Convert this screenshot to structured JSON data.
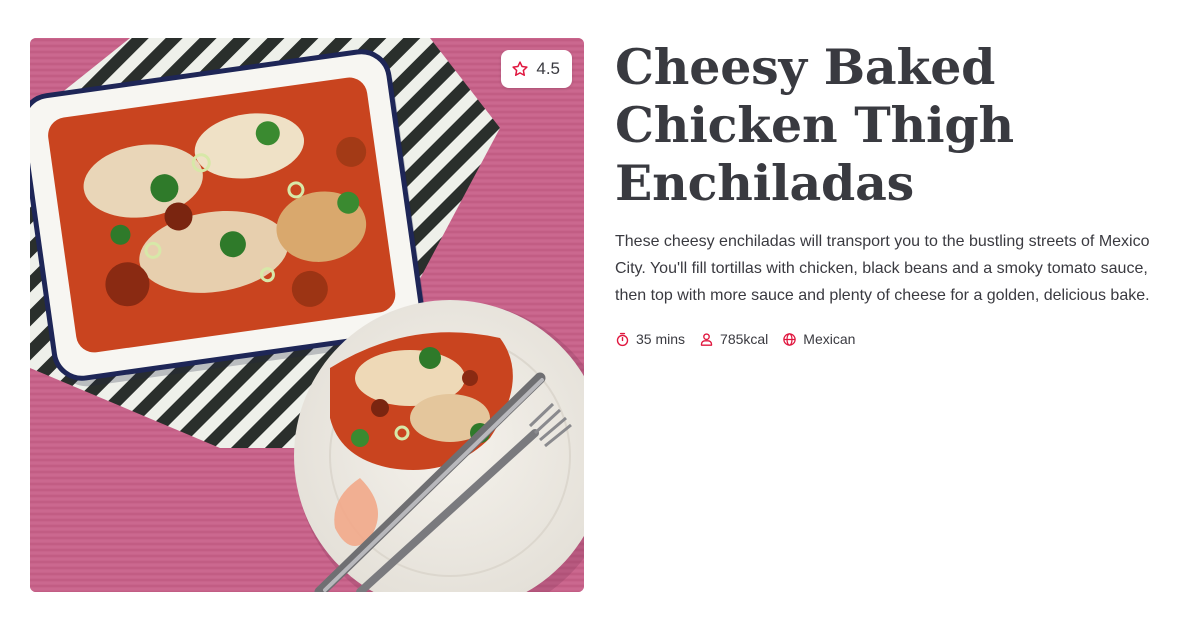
{
  "recipe": {
    "title": "Cheesy Baked Chicken Thigh Enchiladas",
    "description": "These cheesy enchiladas will transport you to the bustling streets of Mexico City. You'll fill tortillas with chicken, black beans and a smoky tomato sauce, then top with more sauce and plenty of cheese for a golden, delicious bake.",
    "rating": "4.5",
    "image_alt": "Baked chicken thigh enchiladas in a white enamel dish beside a plate with a fork and knife on a pink wooden table"
  },
  "meta": [
    {
      "icon": "timer-icon",
      "label": "35 mins"
    },
    {
      "icon": "person-icon",
      "label": "785kcal"
    },
    {
      "icon": "globe-icon",
      "label": "Mexican"
    }
  ],
  "colors": {
    "accent": "#e0173f",
    "text": "#393a40",
    "background_photo": "#c9658c"
  }
}
